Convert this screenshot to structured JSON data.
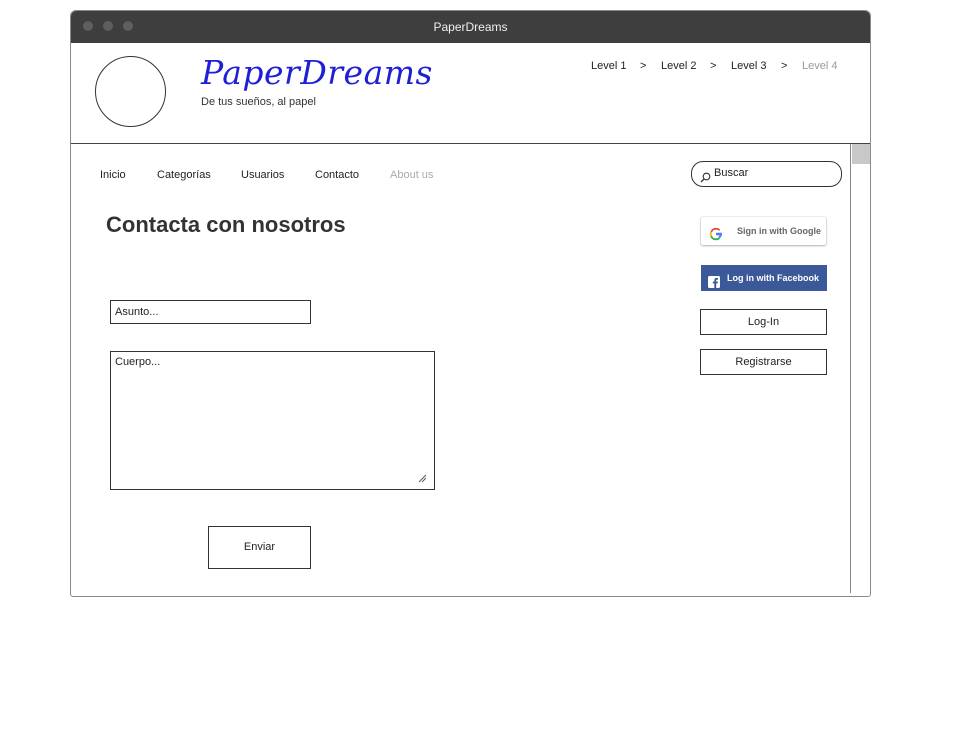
{
  "window": {
    "title": "PaperDreams"
  },
  "header": {
    "brand": "PaperDreams",
    "tagline": "De tus sueños, al papel",
    "breadcrumb": [
      {
        "label": "Level 1"
      },
      {
        "label": "Level 2"
      },
      {
        "label": "Level 3"
      },
      {
        "label": "Level 4"
      }
    ],
    "breadcrumb_separator": ">"
  },
  "nav": {
    "items": [
      {
        "label": "Inicio"
      },
      {
        "label": "Categorías"
      },
      {
        "label": "Usuarios"
      },
      {
        "label": "Contacto"
      },
      {
        "label": "About us"
      }
    ]
  },
  "search": {
    "placeholder": "Buscar",
    "icon": "search-icon"
  },
  "main": {
    "title": "Contacta con nosotros",
    "subject_placeholder": "Asunto...",
    "body_placeholder": "Cuerpo...",
    "send_label": "Enviar"
  },
  "auth": {
    "google_label": "Sign in with Google",
    "facebook_label": "Log in with Facebook",
    "login_label": "Log-In",
    "register_label": "Registrarse"
  },
  "colors": {
    "titlebar": "#3e3e3e",
    "brand": "#1f1fd6",
    "facebook": "#3b5998",
    "disabled_text": "#999999"
  }
}
